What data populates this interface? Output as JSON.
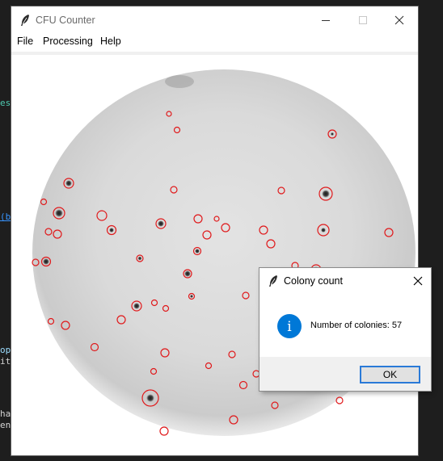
{
  "editor_background": {
    "fragments": [
      {
        "text": "es",
        "color": "#4ec9b0"
      },
      {
        "text": "(bl",
        "color": "#3794ff"
      },
      {
        "text": "ope",
        "color": "#9cdcfe"
      },
      {
        "text": "it)",
        "color": "#d4d4d4"
      },
      {
        "text": "har",
        "color": "#d4d4d4"
      },
      {
        "text": "enu",
        "color": "#d4d4d4"
      }
    ]
  },
  "window": {
    "title": "CFU Counter",
    "title_icon": "feather-icon",
    "controls": [
      "minimize-icon",
      "maximize-icon",
      "close-icon"
    ]
  },
  "menu": {
    "items": [
      {
        "label": "File"
      },
      {
        "label": "Processing"
      },
      {
        "label": "Help"
      }
    ]
  },
  "plate": {
    "marker_color": "#e0191b",
    "colonies_marked": 57
  },
  "dialog": {
    "title": "Colony count",
    "title_icon": "feather-icon",
    "close_icon": "close-icon",
    "info_icon": "info-icon",
    "info_glyph": "i",
    "message": "Number of colonies: 57",
    "ok_label": "OK",
    "accent_color": "#0078d7"
  }
}
